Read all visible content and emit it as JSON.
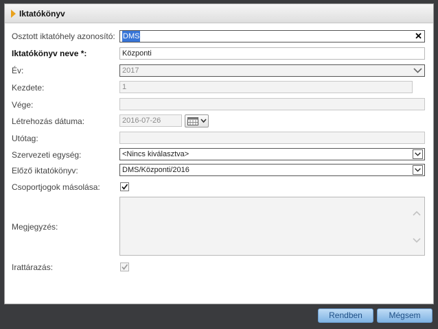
{
  "dialog": {
    "title": "Iktatókönyv"
  },
  "form": {
    "shared_id": {
      "label": "Osztott iktatóhely azonosító:",
      "value": "DMS"
    },
    "name": {
      "label": "Iktatókönyv neve *:",
      "value": "Központi"
    },
    "year": {
      "label": "Év:",
      "value": "2017"
    },
    "start": {
      "label": "Kezdete:",
      "value": "1"
    },
    "end": {
      "label": "Vége:",
      "value": ""
    },
    "created": {
      "label": "Létrehozás dátuma:",
      "value": "2016-07-26"
    },
    "suffix": {
      "label": "Utótag:",
      "value": ""
    },
    "org_unit": {
      "label": "Szervezeti egység:",
      "value": "<Nincs kiválasztva>"
    },
    "prev_book": {
      "label": "Előző iktatókönyv:",
      "value": "DMS/Központi/2016"
    },
    "copy_groups": {
      "label": "Csoportjogok másolása:",
      "checked": true
    },
    "note": {
      "label": "Megjegyzés:",
      "value": ""
    },
    "archived": {
      "label": "Irattárazás:",
      "checked": true
    }
  },
  "buttons": {
    "ok": "Rendben",
    "cancel": "Mégsem"
  }
}
